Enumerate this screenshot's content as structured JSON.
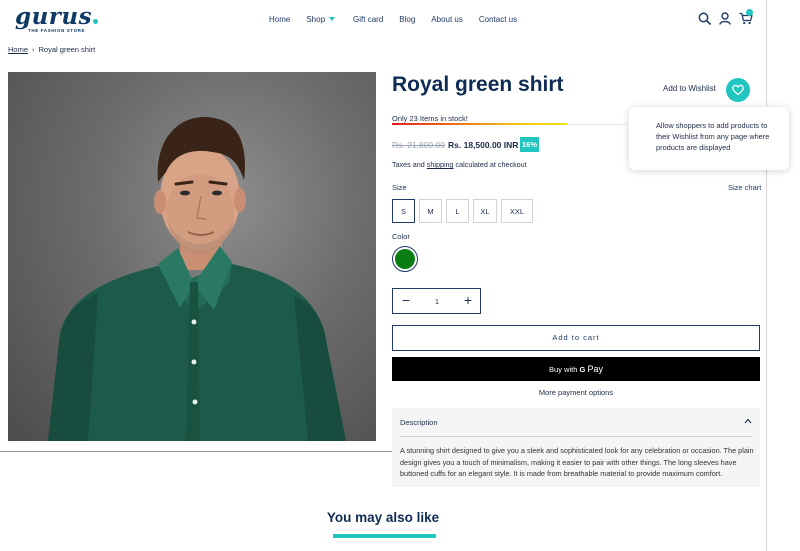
{
  "brand": {
    "name": "gurus",
    "tagline": "THE FASHION STORE",
    "accent": "#21c6c0",
    "primary": "#0f2c55"
  },
  "nav": {
    "items": [
      "Home",
      "Shop",
      "Gift card",
      "Blog",
      "About us",
      "Contact us"
    ]
  },
  "header_icons": [
    "search-icon",
    "account-icon",
    "cart-icon"
  ],
  "breadcrumb": {
    "home": "Home",
    "sep": "›",
    "current": "Royal green shirt"
  },
  "product": {
    "title": "Royal green shirt",
    "stock_text": "Only 23 Items in stock!",
    "stock_level": 0.74,
    "price_old": "Rs. 21,800.00",
    "price_new": "Rs. 18,500.00 INR",
    "discount": "16%",
    "taxes_pre": "Taxes and ",
    "taxes_link": "shipping",
    "taxes_post": " calculated at checkout",
    "size_label": "Size",
    "size_chart": "Size chart",
    "sizes": [
      "S",
      "M",
      "L",
      "XL",
      "XXL"
    ],
    "selected_size": "S",
    "color_label": "Color",
    "color_value": "#0a7d12",
    "quantity": "1",
    "add_to_cart": "Add to cart",
    "buy_with": "Buy with",
    "gpay_g": "G",
    "gpay_pay": "Pay",
    "more_payment": "More payment options",
    "description_title": "Description",
    "description": "A stunning shirt designed to give you a sleek and sophisticated look for any celebration or occasion. The plain design gives you a touch of minimalism, making it easier to pair with other things. The long sleeves have buttoned cuffs for an elegant style. It is made from breathable material to provide maximum comfort."
  },
  "wishlist": {
    "label": "Add to Wishlist",
    "tooltip": "Allow shoppers to add products to their Wishlist from any page where products are displayed"
  },
  "related": {
    "title": "You may also like"
  }
}
